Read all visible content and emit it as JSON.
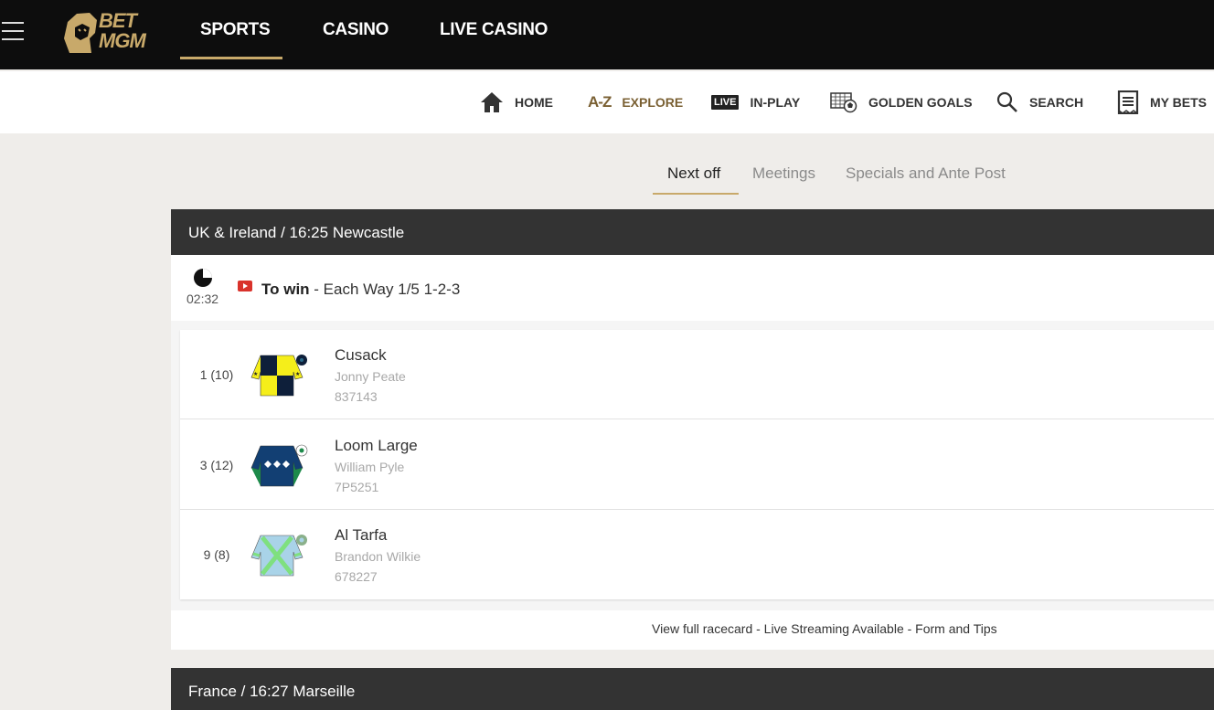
{
  "header": {
    "logo_line1": "BET",
    "logo_line2": "MGM",
    "nav": [
      "SPORTS",
      "CASINO",
      "LIVE CASINO"
    ]
  },
  "subnav": {
    "home": "HOME",
    "explore_icon": "A-Z",
    "explore": "EXPLORE",
    "live_badge": "LIVE",
    "inplay": "IN-PLAY",
    "golden_goals": "GOLDEN GOALS",
    "search": "SEARCH",
    "my_bets": "MY BETS"
  },
  "tabs": [
    "Next off",
    "Meetings",
    "Specials and Ante Post"
  ],
  "races": [
    {
      "header": "UK & Ireland / 16:25 Newcastle",
      "timer": "02:32",
      "market_bold": "To win",
      "market_rest": " - Each Way 1/5 1-2-3",
      "runners": [
        {
          "num": "1 (10)",
          "name": "Cusack",
          "jockey": "Jonny Peate",
          "form": "837143"
        },
        {
          "num": "3 (12)",
          "name": "Loom Large",
          "jockey": "William Pyle",
          "form": "7P5251"
        },
        {
          "num": "9 (8)",
          "name": "Al Tarfa",
          "jockey": "Brandon Wilkie",
          "form": "678227"
        }
      ],
      "footer_link": "View full racecard - Live Streaming Available - Form and Tips"
    },
    {
      "header": "France / 16:27 Marseille"
    }
  ],
  "colors": {
    "accent_gold": "#c8a96a",
    "topbar_bg": "#0d0d0d",
    "race_header_bg": "#333333"
  }
}
